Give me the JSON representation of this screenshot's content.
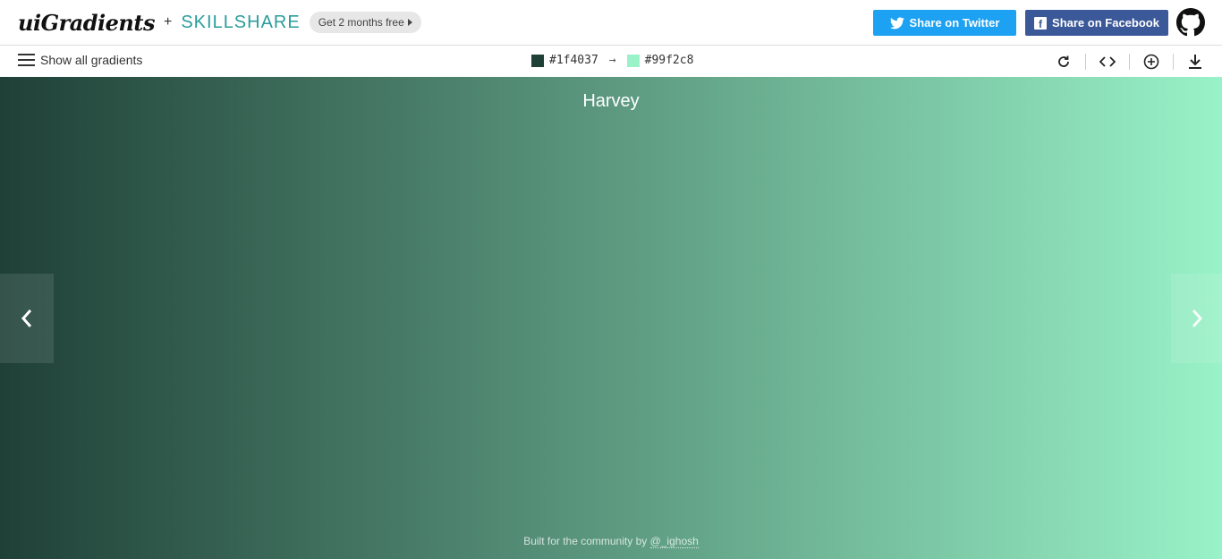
{
  "header": {
    "logo": "uiGradients",
    "plus": "+",
    "partner": "SKILLSHARE",
    "promo_label": "Get 2 months free",
    "twitter_label": "Share on Twitter",
    "facebook_label": "Share on Facebook",
    "github_icon": "github-icon"
  },
  "toolbar": {
    "show_all_label": "Show all gradients",
    "color_from": "#1f4037",
    "arrow": "→",
    "color_to": "#99f2c8",
    "tools": [
      "rotate-icon",
      "code-icon",
      "add-icon",
      "download-icon"
    ]
  },
  "gradient": {
    "name": "Harvey",
    "from": "#1f4037",
    "to": "#99f2c8",
    "prev_icon": "chevron-left-icon",
    "next_icon": "chevron-right-icon"
  },
  "footer": {
    "text": "Built for the community by ",
    "handle": "@_ighosh"
  },
  "colors": {
    "twitter": "#1da1f2",
    "facebook": "#3b5998",
    "skillshare": "#2a9d9c"
  }
}
